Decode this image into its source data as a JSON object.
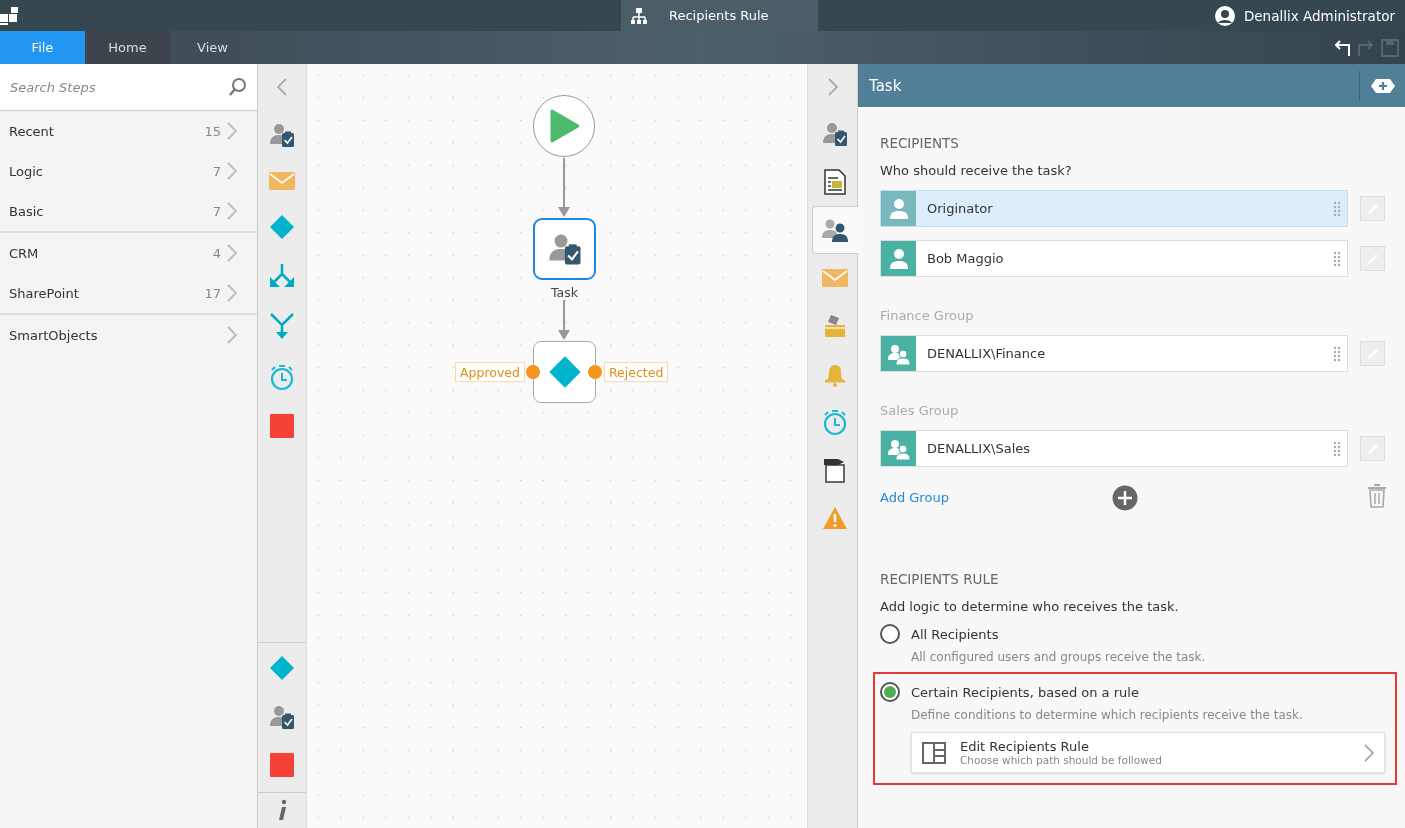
{
  "top_bar": {
    "document_title": "Recipients Rule",
    "user": "Denallix Administrator"
  },
  "ribbon_tabs": [
    {
      "label": "File",
      "selected": true
    },
    {
      "label": "Home",
      "selected": false
    },
    {
      "label": "View",
      "selected": false
    }
  ],
  "search": {
    "placeholder": "Search Steps"
  },
  "step_groups": [
    {
      "items": [
        {
          "label": "Recent",
          "count": "15"
        },
        {
          "label": "Logic",
          "count": "7"
        },
        {
          "label": "Basic",
          "count": "7"
        }
      ]
    },
    {
      "items": [
        {
          "label": "CRM",
          "count": "4"
        },
        {
          "label": "SharePoint",
          "count": "17"
        }
      ]
    },
    {
      "items": [
        {
          "label": "SmartObjects"
        }
      ]
    }
  ],
  "toolbox": {
    "items": [
      {
        "kind": "task"
      },
      {
        "kind": "mail"
      },
      {
        "kind": "decision"
      },
      {
        "kind": "split"
      },
      {
        "kind": "merge"
      },
      {
        "kind": "timer"
      },
      {
        "kind": "end"
      }
    ],
    "pinned": [
      {
        "kind": "decision"
      },
      {
        "kind": "task"
      },
      {
        "kind": "end"
      }
    ]
  },
  "canvas": {
    "task_label": "Task",
    "outcomes": [
      "Approved",
      "Rejected"
    ]
  },
  "side_tabs": [
    {
      "kind": "task",
      "selected": false
    },
    {
      "kind": "form",
      "selected": false
    },
    {
      "kind": "recipients",
      "selected": true
    },
    {
      "kind": "mail",
      "selected": false
    },
    {
      "kind": "inbox",
      "selected": false
    },
    {
      "kind": "bell",
      "selected": false
    },
    {
      "kind": "timer",
      "selected": false
    },
    {
      "kind": "plug",
      "selected": false
    },
    {
      "kind": "warning",
      "selected": false
    }
  ],
  "panel": {
    "title": "Task",
    "recipients": {
      "heading": "RECIPIENTS",
      "question": "Who should receive the task?",
      "entries": [
        {
          "kind": "user",
          "name": "Originator",
          "selected": true
        },
        {
          "kind": "user",
          "name": "Bob Maggio",
          "selected": false
        },
        {
          "kind": "group",
          "group_label": "Finance Group",
          "name": "DENALLIX\\Finance",
          "selected": false
        },
        {
          "kind": "group",
          "group_label": "Sales Group",
          "name": "DENALLIX\\Sales",
          "selected": false
        }
      ],
      "add_group": "Add Group"
    },
    "rule": {
      "heading": "RECIPIENTS RULE",
      "description": "Add logic to determine who receives the task.",
      "options": [
        {
          "label": "All Recipients",
          "description": "All configured users and groups receive the task.",
          "selected": false,
          "highlighted": false
        },
        {
          "label": "Certain Recipients, based on a rule",
          "description": "Define conditions to determine which recipients receive the task.",
          "selected": true,
          "highlighted": true,
          "action": {
            "title": "Edit Recipients Rule",
            "subtitle": "Choose which path should be followed"
          }
        }
      ]
    }
  }
}
